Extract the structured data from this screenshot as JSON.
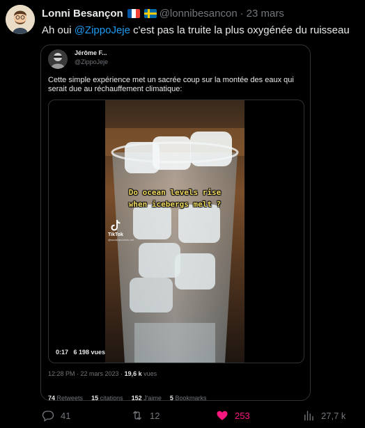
{
  "tweet": {
    "author_name": "Lonni Besançon",
    "flags": [
      "fr-flag",
      "se-flag"
    ],
    "handle": "@lonnibesancon",
    "separator": "·",
    "date": "23 mars",
    "text_before": "Ah oui ",
    "mention": "@ZippoJeje",
    "text_after": " c'est pas la truite la plus oxygénée du ruisseau"
  },
  "quoted": {
    "author_name": "Jérôme F...",
    "handle": "@ZippoJeje",
    "text": "Cette simple expérience met un sacrée coup sur la montée des eaux qui serait due au réchauffement climatique:",
    "video": {
      "caption": "Do ocean levels rise\nwhen icebergs melt ?",
      "watermark_label": "TikTok",
      "watermark_user": "@sociallabuninfo.net",
      "duration": "0:17",
      "views": "6 198 vues"
    },
    "meta": {
      "time_date": "12:28 PM · 22 mars 2023 · ",
      "view_count": "19,6 k",
      "view_label": " vues"
    },
    "stats": [
      {
        "count": "74",
        "label": "Retweets"
      },
      {
        "count": "15",
        "label": "citations"
      },
      {
        "count": "152",
        "label": "J'aime"
      },
      {
        "count": "5",
        "label": "Bookmarks"
      }
    ]
  },
  "actions": {
    "replies": "41",
    "retweets": "12",
    "likes": "253",
    "views": "27,7 k"
  },
  "colors": {
    "background": "#000000",
    "text": "#e7e9ea",
    "muted": "#71767b",
    "link": "#1d9bf0",
    "like": "#f91880",
    "border": "#2f3336",
    "caption": "#f3dc63"
  },
  "icons": [
    "reply-icon",
    "retweet-icon",
    "like-icon",
    "views-icon",
    "tiktok-icon"
  ]
}
